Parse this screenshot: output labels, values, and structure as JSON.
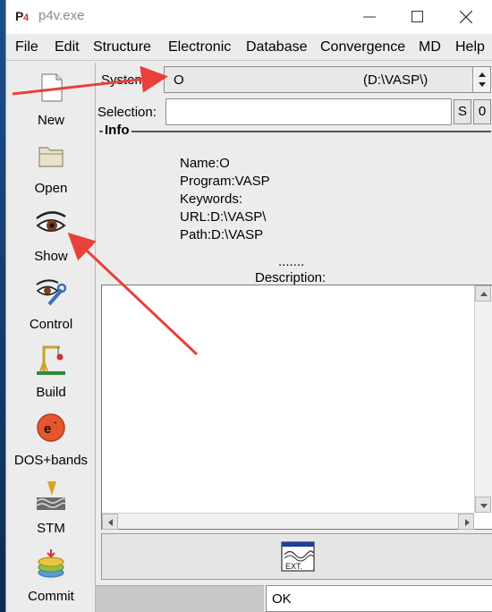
{
  "window": {
    "title": "p4v.exe"
  },
  "menu": [
    "File",
    "Edit",
    "Structure",
    "Electronic",
    "Database",
    "Convergence",
    "MD",
    "Help"
  ],
  "toolbar": [
    {
      "label": "New",
      "icon": "new-document-icon"
    },
    {
      "label": "Open",
      "icon": "folder-open-icon"
    },
    {
      "label": "Show",
      "icon": "eye-icon"
    },
    {
      "label": "Control",
      "icon": "eye-wrench-icon"
    },
    {
      "label": "Build",
      "icon": "crane-icon"
    },
    {
      "label": "DOS+bands",
      "icon": "electron-icon"
    },
    {
      "label": "STM",
      "icon": "stm-tip-icon"
    },
    {
      "label": "Commit",
      "icon": "database-stack-icon"
    }
  ],
  "system": {
    "label": "System:",
    "name": "O",
    "path": "(D:\\VASP\\)"
  },
  "selection": {
    "label": "Selection:",
    "value": "",
    "s_button": "S",
    "count": "0"
  },
  "info": {
    "legend": "Info",
    "lines": [
      "Name:O",
      "Program:VASP",
      "Keywords:",
      "URL:D:\\VASP\\",
      "Path:D:\\VASP"
    ],
    "separator": ".......",
    "description_label": "Description:",
    "description_text": ""
  },
  "ext_button": {
    "label": "EXT."
  },
  "status": {
    "message": "OK"
  },
  "colors": {
    "annotation_arrow": "#e8413b",
    "window_bg": "#ececec"
  }
}
